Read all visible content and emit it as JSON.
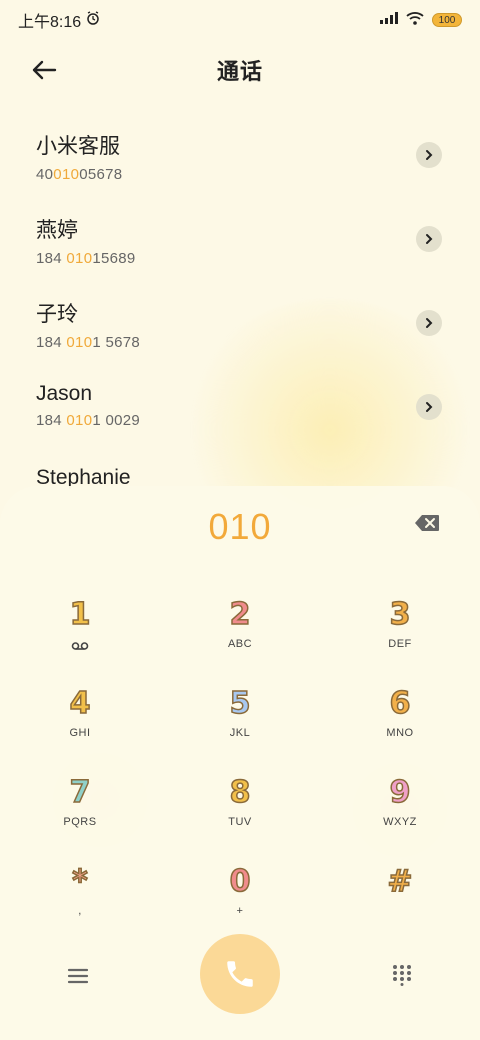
{
  "status_bar": {
    "time": "上午8:16",
    "battery": "100"
  },
  "header": {
    "title": "通话"
  },
  "results": [
    {
      "name": "小米客服",
      "number_before": "40",
      "number_match": "010",
      "number_after": "05678"
    },
    {
      "name": "燕婷",
      "number_before": "184 ",
      "number_match": "010",
      "number_after": "15689"
    },
    {
      "name": "子玲",
      "number_before": "184 ",
      "number_match": "010",
      "number_after": "1 5678"
    },
    {
      "name": "Jason",
      "number_before": "184 ",
      "number_match": "010",
      "number_after": "1 0029"
    },
    {
      "name": "Stephanie",
      "number_before": "",
      "number_match": "",
      "number_after": ""
    }
  ],
  "dialer": {
    "input": "010",
    "keys": [
      {
        "digit": "1",
        "letters": "",
        "color": "#f2c04a"
      },
      {
        "digit": "2",
        "letters": "ABC",
        "color": "#f08c8c"
      },
      {
        "digit": "3",
        "letters": "DEF",
        "color": "#f2b04a"
      },
      {
        "digit": "4",
        "letters": "GHI",
        "color": "#f2c04a"
      },
      {
        "digit": "5",
        "letters": "JKL",
        "color": "#a8c8f0"
      },
      {
        "digit": "6",
        "letters": "MNO",
        "color": "#f2b04a"
      },
      {
        "digit": "7",
        "letters": "PQRS",
        "color": "#8fd0c8"
      },
      {
        "digit": "8",
        "letters": "TUV",
        "color": "#f2c04a"
      },
      {
        "digit": "9",
        "letters": "WXYZ",
        "color": "#f0a0c8"
      },
      {
        "digit": "*",
        "letters": ",",
        "color": "#f2a08a"
      },
      {
        "digit": "0",
        "letters": "+",
        "color": "#f08c8c"
      },
      {
        "digit": "#",
        "letters": "",
        "color": "#f2b04a"
      }
    ]
  },
  "colors": {
    "accent": "#f2a93a",
    "call_button": "#fbd997",
    "background": "#fdf9e6"
  }
}
